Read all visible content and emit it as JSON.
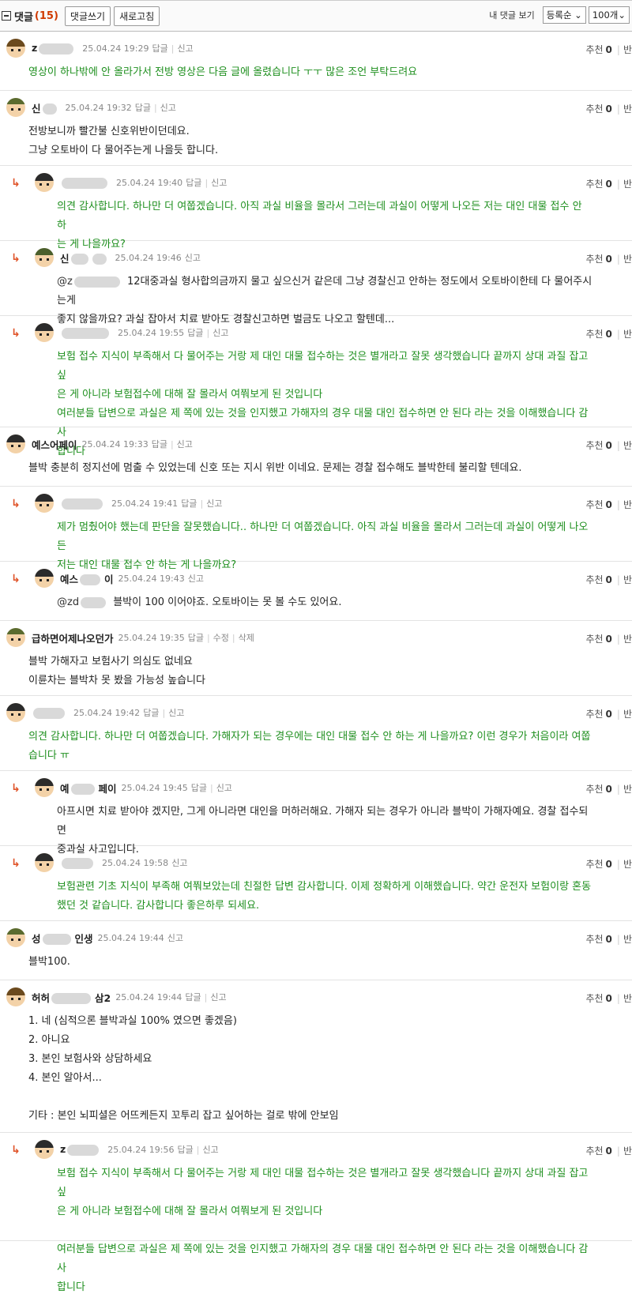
{
  "topbar": {
    "title": "댓글",
    "count": "(15)",
    "write_label": "댓글쓰기",
    "refresh_label": "새로고침",
    "mine_label": "내 댓글 보기",
    "sort_value": "등록순",
    "per_page_value": "100개"
  },
  "labels": {
    "recommend": "추천",
    "reply_cut": "반"
  },
  "comments": [
    {
      "nick": "z",
      "date": "25.04.24 19:29",
      "actions": [
        "답글",
        "신고"
      ],
      "recommend": "0",
      "lines": [
        "영상이 하나밖에 안 올라가서 전방 영상은 다음 글에 올렸습니다 ㅜㅜ 많은 조언 부탁드려요"
      ]
    },
    {
      "nick": "신",
      "date": "25.04.24 19:32",
      "actions": [
        "답글",
        "신고"
      ],
      "recommend": "0",
      "lines": [
        "전방보니까 빨간불 신호위반이던데요.",
        "그냥 오토바이 다 물어주는게 나을듯 합니다."
      ]
    },
    {
      "nick": "",
      "date": "25.04.24 19:40",
      "actions": [
        "답글",
        "신고"
      ],
      "recommend": "0",
      "lines": [
        "의견 감사합니다. 하나만 더 여쭙겠습니다. 아직 과실 비율을 몰라서 그러는데 과실이 어떻게 나오든 저는 대인 대물 접수 안 하",
        "는 게 나을까요?"
      ]
    },
    {
      "nick": "신",
      "nick_tail": "",
      "date": "25.04.24 19:46",
      "actions": [
        "신고"
      ],
      "recommend": "0",
      "mention": "@z",
      "lines": [
        "12대중과실 형사합의금까지 물고 싶으신거 같은데 그냥 경찰신고 안하는 정도에서 오토바이한테 다 물어주시는게",
        "좋지 않을까요? 과실 잡아서 치료 받아도 경찰신고하면 벌금도 나오고 할텐데..."
      ]
    },
    {
      "nick": "",
      "date": "25.04.24 19:55",
      "actions": [
        "답글",
        "신고"
      ],
      "recommend": "0",
      "lines": [
        "보험 접수 지식이 부족해서 다 물어주는 거랑 제 대인 대물 접수하는 것은 별개라고 잘못 생각했습니다 끝까지 상대 과질 잡고 싶",
        "은 게 아니라 보험접수에 대해 잘 몰라서 여쭤보게 된 것입니다",
        "여러분들 답변으로 과실은 제 쪽에 있는 것을 인지했고 가해자의 경우 대물 대인 접수하면 안 된다 라는 것을 이해했습니다 감사",
        "합니다"
      ]
    },
    {
      "nick": "예스어페이",
      "date": "25.04.24 19:33",
      "actions": [
        "답글",
        "신고"
      ],
      "recommend": "0",
      "lines": [
        "블박 충분히 정지선에 멈출 수 있었는데 신호 또는 지시 위반 이네요. 문제는 경찰 접수해도 블박한테 불리할 텐데요."
      ]
    },
    {
      "nick": "",
      "date": "25.04.24 19:41",
      "actions": [
        "답글",
        "신고"
      ],
      "recommend": "0",
      "lines": [
        "제가 멈췄어야 했는데 판단을 잘못했습니다.. 하나만 더 여쭙겠습니다. 아직 과실 비율을 몰라서 그러는데 과실이 어떻게 나오든",
        "저는 대인 대물 접수 안 하는 게 나을까요?"
      ]
    },
    {
      "nick": "예스",
      "nick_tail": "이",
      "date": "25.04.24 19:43",
      "actions": [
        "신고"
      ],
      "recommend": "0",
      "mention": "@zd",
      "lines": [
        "블박이 100 이어야죠. 오토바이는 못 볼 수도 있어요."
      ]
    },
    {
      "nick": "급하면어제나오던가",
      "date": "25.04.24 19:35",
      "actions": [
        "답글",
        "수정",
        "삭제"
      ],
      "recommend": "0",
      "lines": [
        "블박 가해자고 보험사기 의심도 없네요",
        "이륜차는 블박차 못 봤을 가능성 높습니다"
      ]
    },
    {
      "nick": "",
      "date": "25.04.24 19:42",
      "actions": [
        "답글",
        "신고"
      ],
      "recommend": "0",
      "lines": [
        "의견 감사합니다. 하나만 더 여쭙겠습니다. 가해자가 되는 경우에는 대인 대물 접수 안 하는 게 나을까요? 이런 경우가 처음이라 여쭙",
        "습니다 ㅠ"
      ]
    },
    {
      "nick": "예",
      "nick_tail": "페이",
      "date": "25.04.24 19:45",
      "actions": [
        "답글",
        "신고"
      ],
      "recommend": "0",
      "lines": [
        "아프시면 치료 받아야 겠지만, 그게 아니라면 대인을 머하러해요. 가해자 되는 경우가 아니라 블박이 가해자예요. 경찰 접수되면",
        "중과실 사고입니다."
      ]
    },
    {
      "nick": "",
      "date": "25.04.24 19:58",
      "actions": [
        "신고"
      ],
      "recommend": "0",
      "lines": [
        "보험관련 기초 지식이 부족해 여쭤보았는데 친절한 답변 감사합니다. 이제 정확하게 이해했습니다. 약간 운전자 보험이랑 혼동",
        "했던 것 같습니다. 감사합니다 좋은하루 되세요."
      ]
    },
    {
      "nick": "성",
      "nick_tail": "인생",
      "date": "25.04.24 19:44",
      "actions": [
        "신고"
      ],
      "recommend": "0",
      "lines": [
        "블박100."
      ]
    },
    {
      "nick": "허허",
      "nick_tail": "삼2",
      "date": "25.04.24 19:44",
      "actions": [
        "답글",
        "신고"
      ],
      "recommend": "0",
      "lines": [
        "1. 네 (심적으론 블박과실 100% 였으면 좋겠음)",
        "2. 아니요",
        "3. 본인 보험사와 상담하세요",
        "4. 본인 알아서...",
        "",
        "기타 : 본인 뇌피셜은 어뜨케든지 꼬투리 잡고 싶어하는 걸로 밖에 안보임"
      ]
    },
    {
      "nick": "z",
      "date": "25.04.24 19:56",
      "actions": [
        "답글",
        "신고"
      ],
      "recommend": "0",
      "lines": [
        "보험 접수 지식이 부족해서 다 물어주는 거랑 제 대인 대물 접수하는 것은 별개라고 잘못 생각했습니다 끝까지 상대 과질 잡고 싶",
        "은 게 아니라 보험접수에 대해 잘 몰라서 여쭤보게 된 것입니다",
        "",
        "여러분들 답변으로 과실은 제 쪽에 있는 것을 인지했고 가해자의 경우 대물 대인 접수하면 안 된다 라는 것을 이해했습니다 감사",
        "합니다"
      ]
    }
  ]
}
